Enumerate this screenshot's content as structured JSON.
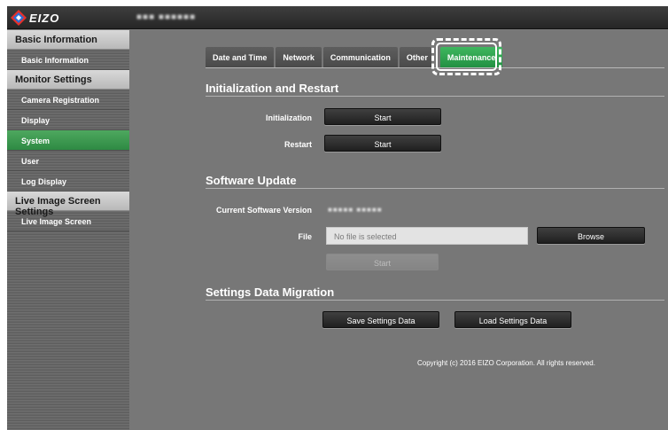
{
  "header": {
    "logo_text": "EIZO",
    "device_name": "■■■ ■■■■■■"
  },
  "sidebar": {
    "groups": [
      {
        "title": "Basic Information",
        "items": [
          {
            "label": "Basic Information"
          }
        ]
      },
      {
        "title": "Monitor Settings",
        "items": [
          {
            "label": "Camera Registration"
          },
          {
            "label": "Display"
          },
          {
            "label": "System"
          },
          {
            "label": "User"
          },
          {
            "label": "Log Display"
          }
        ]
      },
      {
        "title": "Live Image Screen Settings",
        "items": [
          {
            "label": "Live Image Screen"
          }
        ]
      }
    ],
    "active_item": "System"
  },
  "tabs": [
    {
      "label": "Date and Time"
    },
    {
      "label": "Network"
    },
    {
      "label": "Communication"
    },
    {
      "label": "Other"
    },
    {
      "label": "Maintenance"
    }
  ],
  "active_tab": "Maintenance",
  "init_section": {
    "title": "Initialization and Restart",
    "initialization_label": "Initialization",
    "initialization_button": "Start",
    "restart_label": "Restart",
    "restart_button": "Start"
  },
  "update_section": {
    "title": "Software Update",
    "version_label": "Current Software Version",
    "version_value": "■■■■■ ■■■■■",
    "file_label": "File",
    "file_placeholder": "No file is selected",
    "browse_button": "Browse",
    "start_button": "Start"
  },
  "migration_section": {
    "title": "Settings Data Migration",
    "save_button": "Save Settings Data",
    "load_button": "Load Settings Data"
  },
  "footer": {
    "copyright": "Copyright (c) 2016 EIZO Corporation. All rights reserved."
  },
  "colors": {
    "accent_green": "#2e9a48",
    "highlight": "#ffffff"
  }
}
